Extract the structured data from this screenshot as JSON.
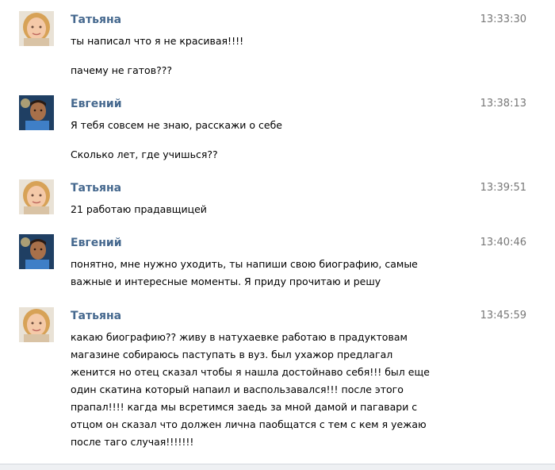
{
  "messages": [
    {
      "author": "Татьяна",
      "avatar": "female-user-avatar",
      "time": "13:33:30",
      "lines": [
        "ты написал что я не красивая!!!!",
        "пачему не гатов???"
      ]
    },
    {
      "author": "Евгений",
      "avatar": "male-user-avatar",
      "time": "13:38:13",
      "lines": [
        "Я тебя совсем не знаю, расскажи о себе",
        "Сколько лет, где учишься??"
      ]
    },
    {
      "author": "Татьяна",
      "avatar": "female-user-avatar",
      "time": "13:39:51",
      "lines": [
        "21 работаю прадавщицей"
      ]
    },
    {
      "author": "Евгений",
      "avatar": "male-user-avatar",
      "time": "13:40:46",
      "lines": [
        "понятно, мне нужно уходить, ты напиши свою биографию, самые",
        "важные и интересные моменты. Я приду прочитаю и решу"
      ]
    },
    {
      "author": "Татьяна",
      "avatar": "female-user-avatar",
      "time": "13:45:59",
      "lines": [
        "какаю биографию?? живу в натухаевке работаю в прадуктовам",
        "магазине собираюсь паступать в вуз. был ухажор предлагал",
        "женится но отец сказал чтобы я нашла достойнаво себя!!! был еще",
        "один скатина который напаил и васпользавался!!! после этого",
        "прапал!!!! кагда мы всретимся заедь за мной дамой и пагавари с",
        "отцом он сказал что должен лична паобщатся с тем с кем я уежаю",
        "после таго случая!!!!!!!"
      ]
    }
  ]
}
